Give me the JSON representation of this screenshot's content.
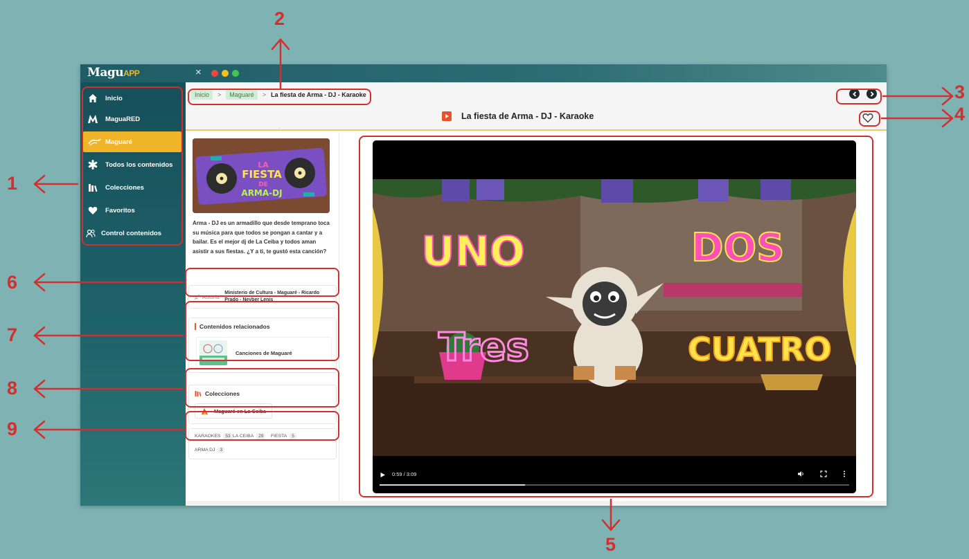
{
  "app": {
    "logo_main": "Magu",
    "logo_app": "APP",
    "close_glyph": "×"
  },
  "sidebar": {
    "items": [
      {
        "label": "Inicio",
        "icon": "home-icon"
      },
      {
        "label": "MaguaRED",
        "icon": "magua-logo-icon"
      },
      {
        "label": "Maguaré",
        "icon": "maguare-icon",
        "active": true
      },
      {
        "label": "Todos los contenidos",
        "icon": "asterisk-icon"
      },
      {
        "label": "Colecciones",
        "icon": "collections-icon"
      },
      {
        "label": "Favoritos",
        "icon": "heart-icon"
      },
      {
        "label": "Control contenidos",
        "icon": "users-icon"
      }
    ]
  },
  "breadcrumb": {
    "home": "Inicio",
    "section": "Maguaré",
    "current": "La fiesta de Arma - DJ - Karaoke",
    "separator": ">"
  },
  "page": {
    "title": "La fiesta de Arma - DJ - Karaoke"
  },
  "thumbnail": {
    "line1": "LA",
    "line2": "FIESTA",
    "line3": "DE",
    "line4": "ARMA-DJ"
  },
  "description": "Arma - DJ es un armadillo que desde temprano toca su música para que todos se pongan a cantar y a bailar. Es el mejor dj de La Ceiba y todos aman asistir a sus fiestas. ¿Y a ti, te gustó esta canción?",
  "authorship": {
    "label": "Autoría:",
    "names": "Ministerio de Cultura - Maguaré - Ricardo Prado - Neyber Lenis"
  },
  "related": {
    "title": "Contenidos relacionados",
    "items": [
      {
        "label": "Canciones de Maguaré"
      }
    ]
  },
  "collections": {
    "title": "Colecciones",
    "items": [
      {
        "label": "Maguaré en La Ceiba"
      }
    ]
  },
  "tags": [
    {
      "name": "KARAOKES",
      "count": "53"
    },
    {
      "name": "LA CEIBA",
      "count": "29"
    },
    {
      "name": "FIESTA",
      "count": "5"
    },
    {
      "name": "ARMA DJ",
      "count": "3"
    }
  ],
  "video": {
    "time": "0:59 / 3:09",
    "progress": 0.31,
    "scene_words": {
      "one": "UNO",
      "two": "DOS",
      "three": "Tres",
      "four": "CUATRO"
    }
  },
  "annotations": [
    "1",
    "2",
    "3",
    "4",
    "5",
    "6",
    "7",
    "8",
    "9"
  ],
  "colors": {
    "accent": "#f0b429",
    "annotation": "#d22f2f",
    "sidebar": "#1c5a63",
    "breadcrumb_chip": "#d2ecd6",
    "background": "#7fb3b3"
  }
}
